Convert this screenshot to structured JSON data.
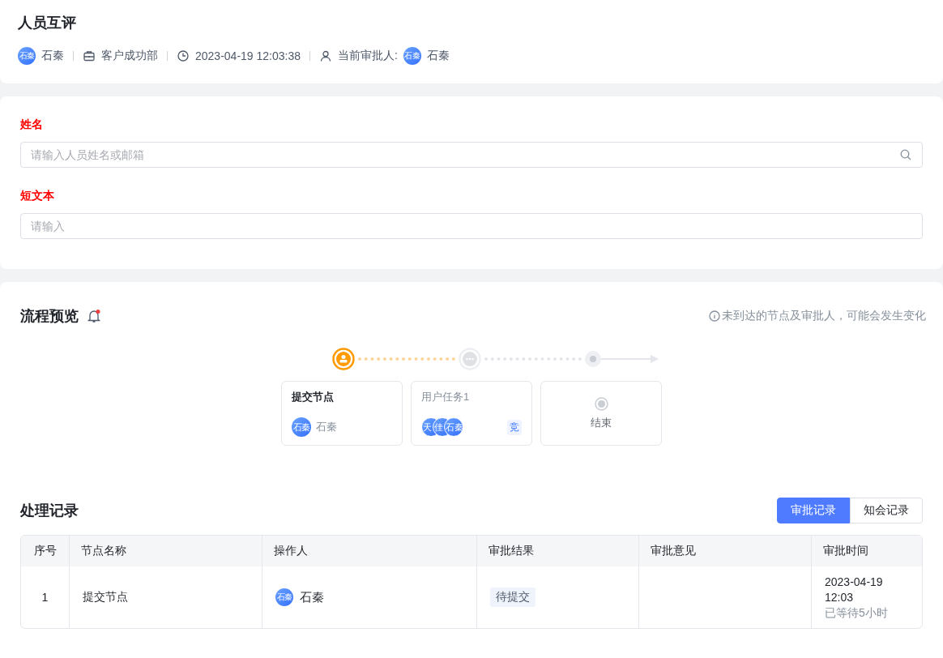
{
  "header": {
    "title": "人员互评",
    "meta": [
      {
        "kind": "avatar",
        "avatar": "石秦",
        "text": "石秦"
      },
      {
        "kind": "department",
        "text": "客户成功部"
      },
      {
        "kind": "time",
        "text": "2023-04-19 12:03:38"
      },
      {
        "kind": "approver",
        "text": "当前审批人:",
        "avatar": "石秦",
        "name": "石秦"
      }
    ]
  },
  "form": {
    "fields": [
      {
        "label": "姓名",
        "placeholder": "请输入人员姓名或邮箱",
        "kind": "search"
      },
      {
        "label": "短文本",
        "placeholder": "请输入",
        "kind": "text"
      }
    ]
  },
  "flow": {
    "title": "流程预览",
    "notice": "未到达的节点及审批人，可能会发生变化",
    "nodes": [
      {
        "kind": "start",
        "title": "提交节点",
        "done": true,
        "people": [
          {
            "avatar": "石秦",
            "name": "石秦"
          }
        ]
      },
      {
        "kind": "task",
        "title": "用户任务1",
        "done": false,
        "avatars": [
          "天",
          "佳",
          "石秦"
        ],
        "badge": "竞"
      },
      {
        "kind": "end",
        "title": "结束"
      }
    ]
  },
  "records": {
    "title": "处理记录",
    "tabs": [
      {
        "label": "审批记录",
        "selected": true
      },
      {
        "label": "知会记录",
        "selected": false
      }
    ],
    "columns": [
      "序号",
      "节点名称",
      "操作人",
      "审批结果",
      "审批意见",
      "审批时间"
    ],
    "rows": [
      {
        "index": "1",
        "node": "提交节点",
        "operator_avatar": "石秦",
        "operator": "石秦",
        "result": "待提交",
        "date": "2023-04-19",
        "time": "12:03",
        "wait": "已等待5小时"
      }
    ]
  }
}
